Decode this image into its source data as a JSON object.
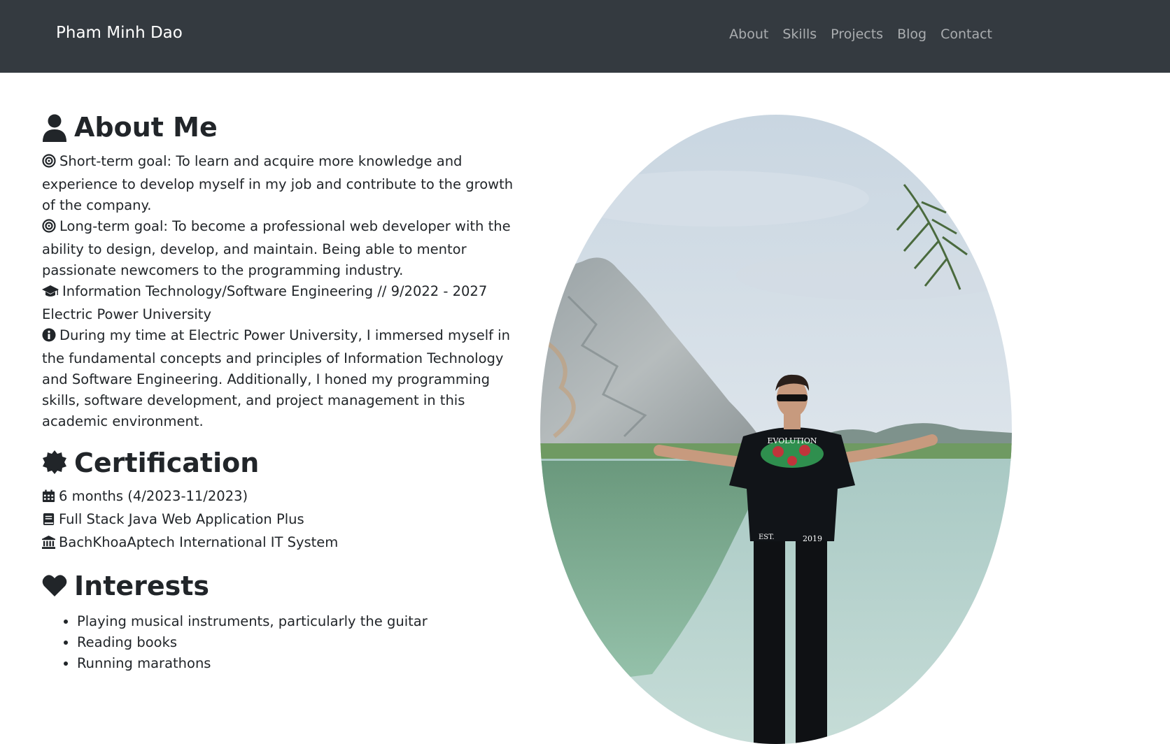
{
  "nav": {
    "brand": "Pham Minh Dao",
    "links": [
      "About",
      "Skills",
      "Projects",
      "Blog",
      "Contact"
    ]
  },
  "about": {
    "heading": "About Me",
    "icon": "user-icon",
    "short_goal": "Short-term goal: To learn and acquire more knowledge and experience to develop myself in my job and contribute to the growth of the company.",
    "long_goal": "Long-term goal: To become a professional web developer with the ability to design, develop, and maintain. Being able to mentor passionate newcomers to the programming industry.",
    "education": "Information Technology/Software Engineering // 9/2022 - 2027",
    "university": "Electric Power University",
    "experience": "During my time at Electric Power University, I immersed myself in the fundamental concepts and principles of Information Technology and Software Engineering. Additionally, I honed my programming skills, software development, and project management in this academic environment."
  },
  "certification": {
    "heading": "Certification",
    "icon": "certificate-icon",
    "duration": "6 months (4/2023-11/2023)",
    "course": "Full Stack Java Web Application Plus",
    "institution": "BachKhoaAptech International IT System"
  },
  "interests": {
    "heading": "Interests",
    "icon": "heart-icon",
    "items": [
      "Playing musical instruments, particularly the guitar",
      "Reading books",
      "Running marathons"
    ]
  },
  "photo": {
    "shirt_text": "EVOLUTION",
    "shirt_est": "EST.",
    "shirt_year": "2019"
  },
  "colors": {
    "navbar_bg": "#343a40",
    "text": "#212529"
  }
}
